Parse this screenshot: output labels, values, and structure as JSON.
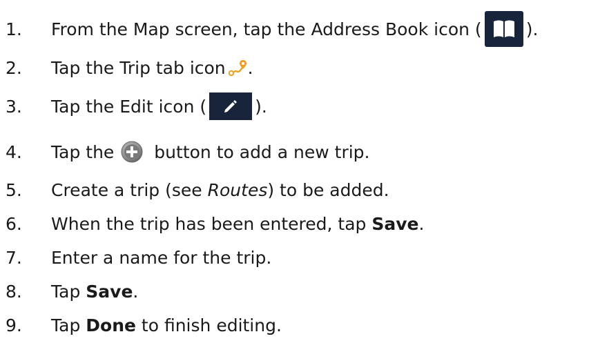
{
  "steps": [
    {
      "num": "1.",
      "before": "From the Map screen, tap the Address Book icon (",
      "after": ")."
    },
    {
      "num": "2.",
      "before": "Tap the Trip tab icon",
      "after": "."
    },
    {
      "num": "3.",
      "before": "Tap the Edit icon (",
      "after": ")."
    },
    {
      "num": "4.",
      "before": "Tap the",
      "after": "button to add a new trip."
    },
    {
      "num": "5.",
      "before": "Create a trip (see ",
      "em": "Routes",
      "after": ") to be added."
    },
    {
      "num": "6.",
      "before": "When the trip has been entered, tap ",
      "strong": "Save",
      "after": "."
    },
    {
      "num": "7.",
      "text": "Enter a name for the trip."
    },
    {
      "num": "8.",
      "before": "Tap ",
      "strong": "Save",
      "after": "."
    },
    {
      "num": "9.",
      "before": "Tap ",
      "strong": "Done",
      "after": " to finish editing."
    }
  ],
  "icons": {
    "address_book": "book-icon",
    "trip_tab": "trip-route-icon",
    "edit": "pencil-icon",
    "add": "plus-circle-icon"
  },
  "colors": {
    "text": "#1a1a1a",
    "icon_background": "#17243a",
    "trip_icon": "#f0a020",
    "add_button": "#8a8a8a"
  }
}
